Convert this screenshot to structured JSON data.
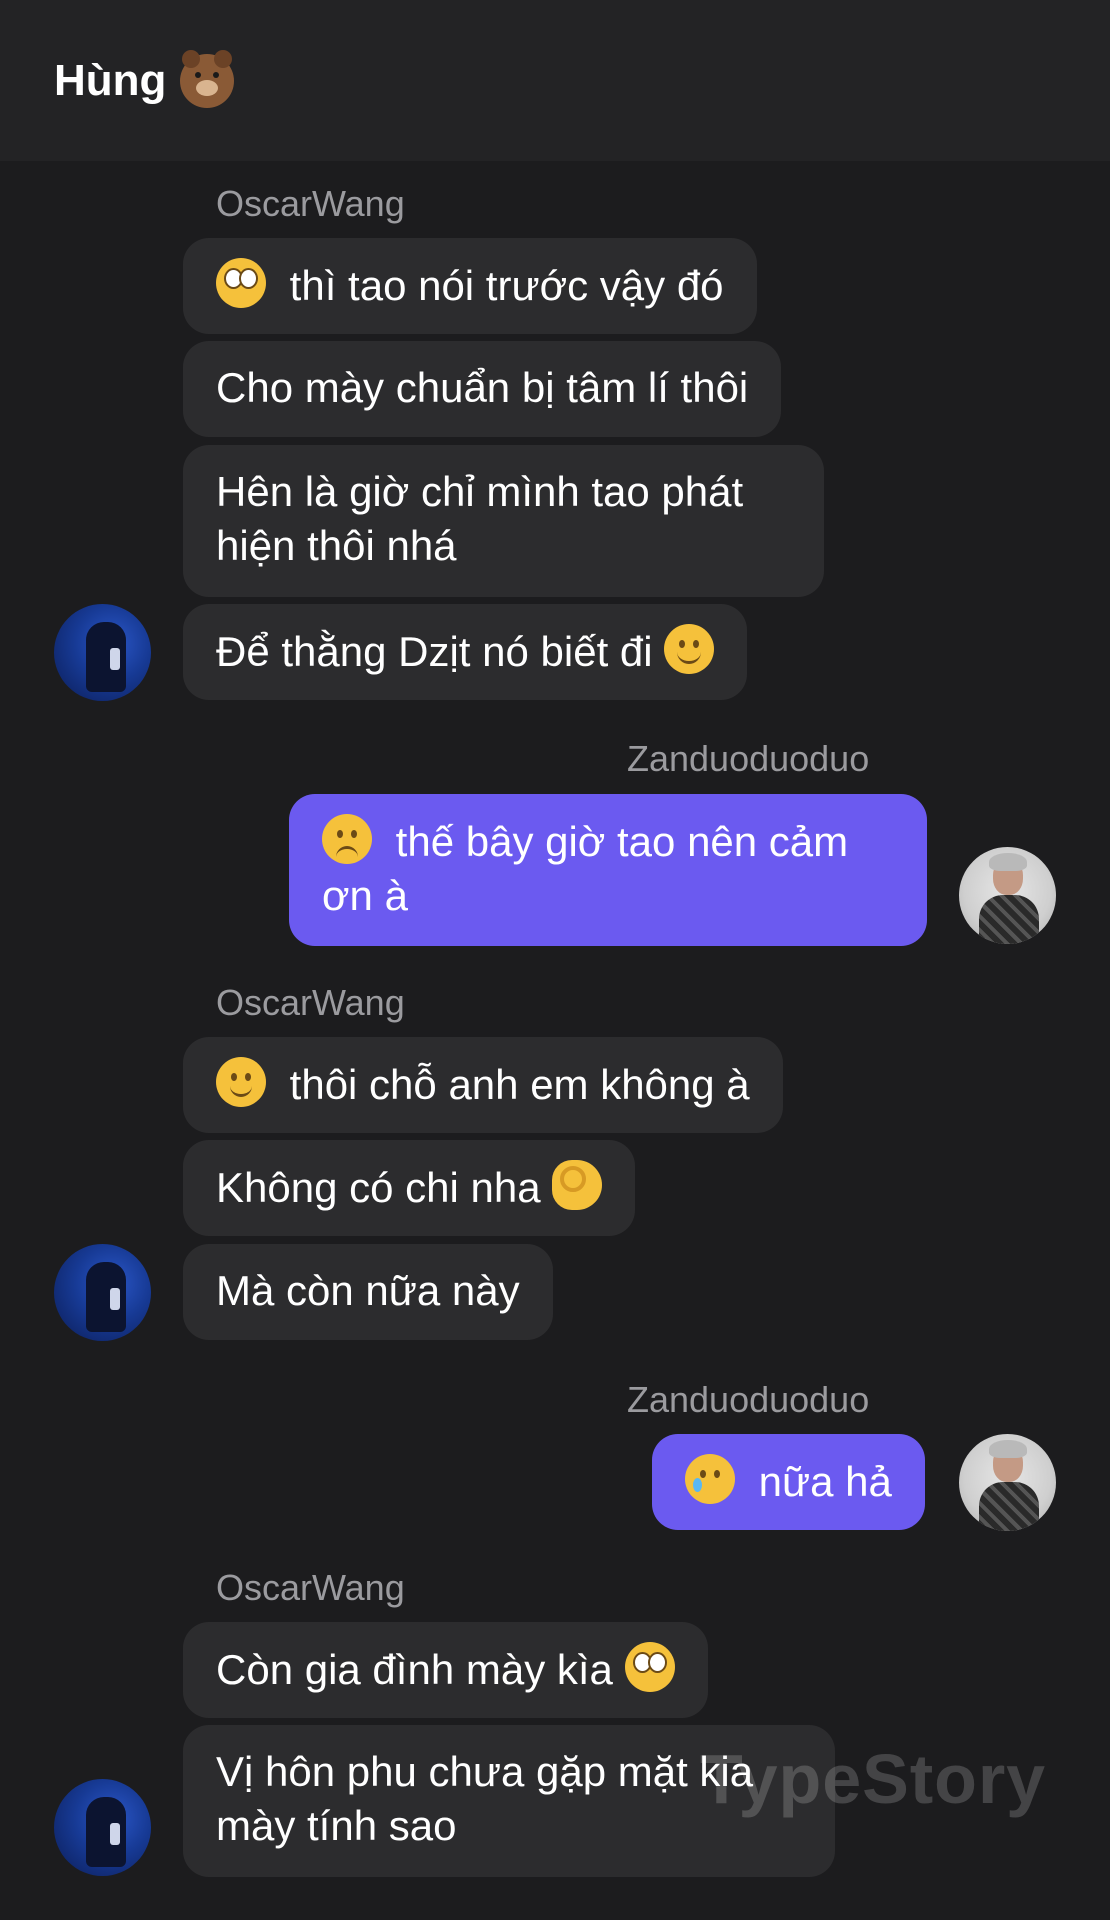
{
  "header": {
    "title": "Hùng",
    "title_icon": "bear-face-icon"
  },
  "messages": {
    "g1_sender": "OscarWang",
    "g1_m1": "thì tao nói trước vậy đó",
    "g1_m2": "Cho mày chuẩn bị tâm lí thôi",
    "g1_m3_l1": "Hên là giờ chỉ mình tao phát",
    "g1_m3_l2": "hiện thôi nhá",
    "g1_m4": "Để thằng Dzịt nó biết đi",
    "g2_sender": "Zanduoduoduo",
    "g2_m1_l1": "thế bây giờ tao nên cảm",
    "g2_m1_l2": "ơn à",
    "g3_sender": "OscarWang",
    "g3_m1": "thôi chỗ anh em không à",
    "g3_m2": "Không có chi nha",
    "g3_m3": "Mà còn nữa này",
    "g4_sender": "Zanduoduoduo",
    "g4_m1": "nữa hả",
    "g5_sender": "OscarWang",
    "g5_m1": "Còn gia đình mày kìa",
    "g5_m2_l1": "Vị hôn phu chưa gặp mặt kia",
    "g5_m2_l2": "mày tính sao"
  },
  "watermark": "TypeStory",
  "colors": {
    "background": "#1c1c1e",
    "header": "#232325",
    "bubble_other": "#2c2c2e",
    "bubble_mine": "#6b5af0",
    "sender": "#9b9b9f"
  }
}
